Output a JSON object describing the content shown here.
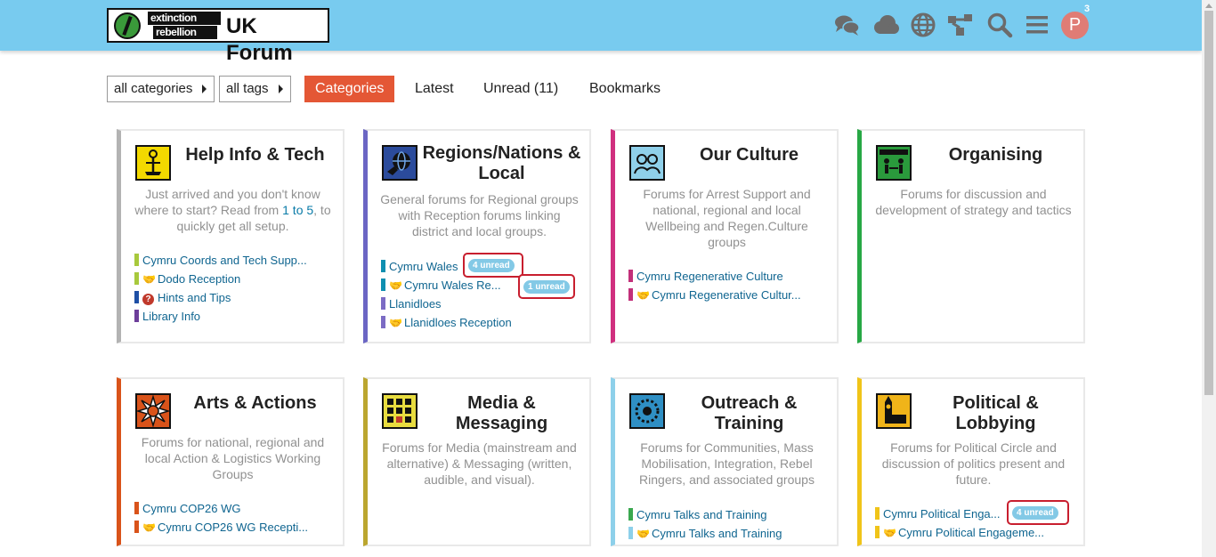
{
  "header": {
    "logo": {
      "line1": "extinction",
      "line2": "rebellion",
      "title": "UK Forum"
    },
    "icons": [
      "chat-icon",
      "cloud-icon",
      "globe-icon",
      "sitemap-icon",
      "search-icon",
      "hamburger-icon"
    ],
    "avatar_letter": "P",
    "notification_count": "3"
  },
  "nav": {
    "category_dropdown": "all categories",
    "tag_dropdown": "all tags",
    "tabs": [
      "Categories",
      "Latest",
      "Unread (11)",
      "Bookmarks"
    ],
    "active_tab": "Categories"
  },
  "colors": {
    "header": "#78cbef",
    "accent": "#e45735",
    "link": "#0f6590",
    "unread_badge": "#83c9e6",
    "highlight_outline": "#c81e2e"
  },
  "categories": [
    {
      "title": "Help Info & Tech",
      "description_parts": [
        "Just arrived and you don't know where to start? Read from ",
        "1 to 5",
        ", to quickly get all setup."
      ],
      "border_color": "#b3b3b3",
      "subcategories": [
        {
          "name": "Cymru Coords and Tech Supp...",
          "color": "#a8c93c"
        },
        {
          "name": "Dodo Reception",
          "color": "#a8c93c",
          "icon": "handshake-icon"
        },
        {
          "name": "Hints and Tips",
          "color": "#1e4fa5",
          "icon": "question-icon"
        },
        {
          "name": "Library Info",
          "color": "#6d3e9a"
        }
      ]
    },
    {
      "title": "Regions/Nations & Local",
      "description": "General forums for Regional groups with Reception forums linking district and local groups.",
      "border_color": "#6b66c4",
      "subcategories": [
        {
          "name": "Cymru Wales",
          "color": "#0f8fb0",
          "unread": "4 unread"
        },
        {
          "name": "Cymru Wales Re...",
          "color": "#0f8fb0",
          "icon": "handshake-icon",
          "unread": "1 unread"
        },
        {
          "name": "Llanidloes",
          "color": "#7b6bc4"
        },
        {
          "name": "Llanidloes Reception",
          "color": "#7b6bc4",
          "icon": "handshake-icon"
        }
      ]
    },
    {
      "title": "Our Culture",
      "description": "Forums for Arrest Support and national, regional and local Wellbeing and Regen.Culture groups",
      "border_color": "#d0307f",
      "subcategories": [
        {
          "name": "Cymru Regenerative Culture",
          "color": "#c2307a"
        },
        {
          "name": "Cymru Regenerative Cultur...",
          "color": "#c2307a",
          "icon": "handshake-icon"
        }
      ]
    },
    {
      "title": "Organising",
      "description": "Forums for discussion and development of strategy and tactics",
      "border_color": "#27a845",
      "subcategories": []
    },
    {
      "title": "Arts & Actions",
      "description": "Forums for national, regional and local Action & Logistics Working Groups",
      "border_color": "#d9531a",
      "subcategories": [
        {
          "name": "Cymru COP26 WG",
          "color": "#d9531a"
        },
        {
          "name": "Cymru COP26 WG Recepti...",
          "color": "#d9531a",
          "icon": "handshake-icon"
        }
      ]
    },
    {
      "title": "Media & Messaging",
      "description": "Forums for Media (mainstream and alternative) & Messaging (written, audible, and visual).",
      "border_color": "#bba62f",
      "subcategories": []
    },
    {
      "title": "Outreach & Training",
      "description": "Forums for Communities, Mass Mobilisation, Integration, Rebel Ringers, and associated groups",
      "border_color": "#8dd0ea",
      "subcategories": [
        {
          "name": "Cymru Talks and Training",
          "color": "#3aa84f"
        },
        {
          "name": "Cymru Talks and Training",
          "color": "#8dd0ea",
          "icon": "handshake-icon"
        }
      ]
    },
    {
      "title": "Political & Lobbying",
      "description": "Forums for Political Circle and discussion of politics present and future.",
      "border_color": "#f0c419",
      "subcategories": [
        {
          "name": "Cymru Political Enga...",
          "color": "#f0c419",
          "unread": "4 unread"
        },
        {
          "name": "Cymru Political Engageme...",
          "color": "#f0c419",
          "icon": "handshake-icon"
        }
      ]
    }
  ]
}
